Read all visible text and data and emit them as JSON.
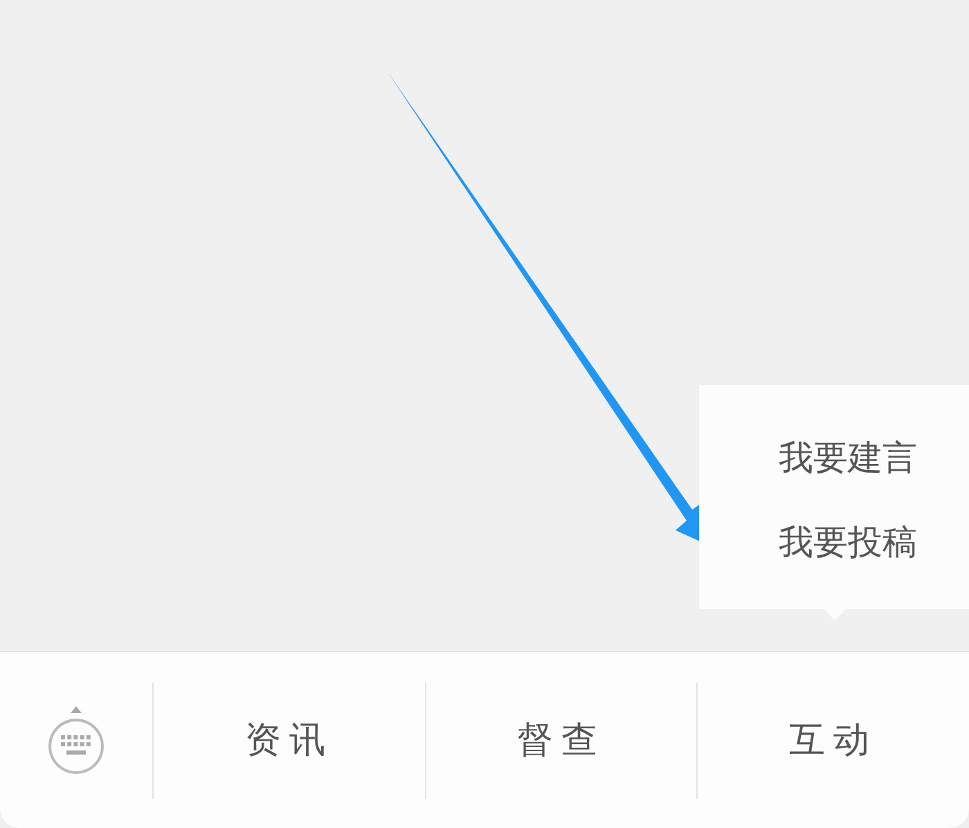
{
  "menu": [
    {
      "label": "资讯"
    },
    {
      "label": "督查"
    },
    {
      "label": "互动",
      "submenu": [
        "我要建言",
        "我要投稿"
      ]
    }
  ]
}
